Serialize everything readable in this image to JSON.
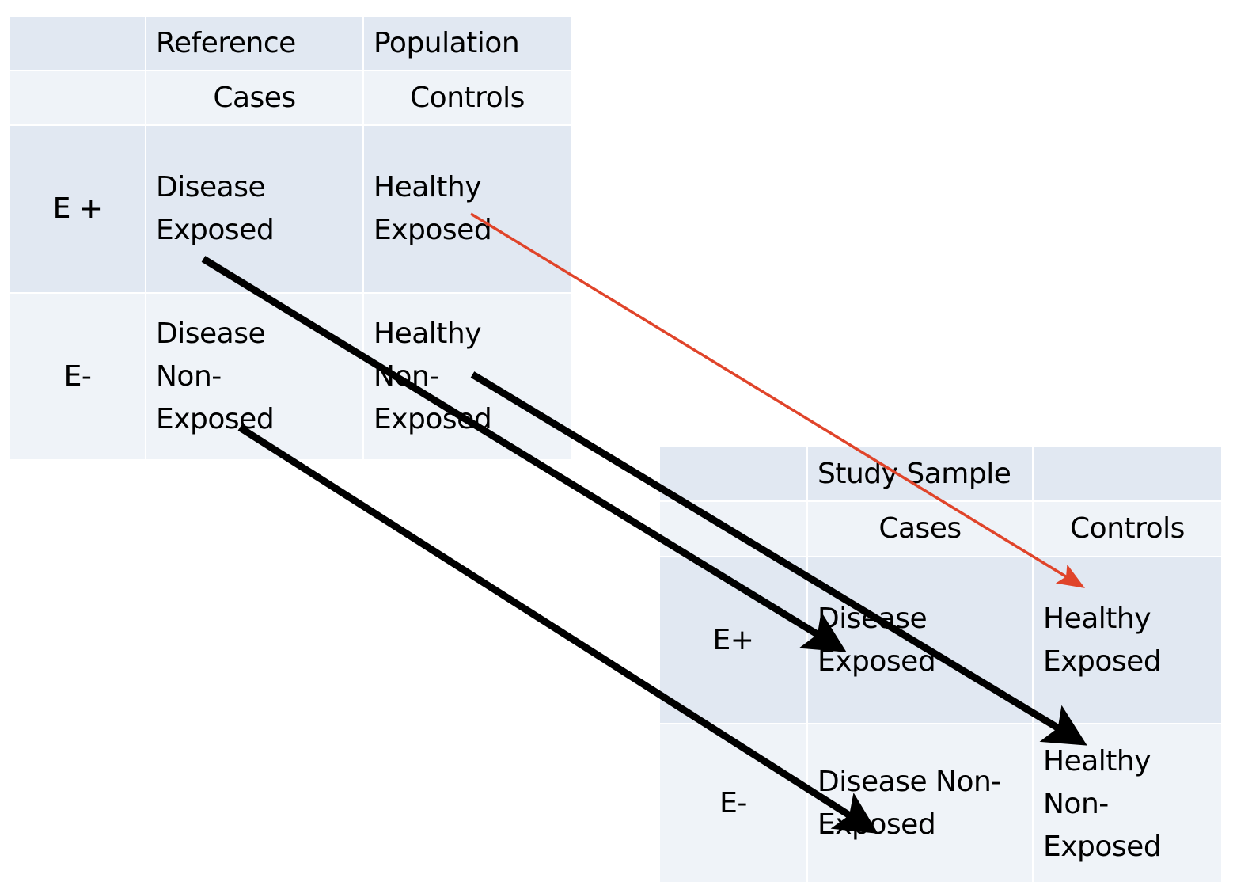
{
  "reference_table": {
    "header_row": [
      "",
      "Reference",
      "Population"
    ],
    "subheader_row": [
      "",
      "Cases",
      "Controls"
    ],
    "rows": [
      {
        "label": "E +",
        "cases": "Disease Exposed",
        "cases_lines": [
          "Disease",
          "Exposed"
        ],
        "controls_lines": [
          "Healthy",
          "Exposed"
        ]
      },
      {
        "label": "E-",
        "cases_lines": [
          "Disease",
          "Non-",
          "Exposed"
        ],
        "controls_lines": [
          "Healthy",
          "Non-",
          "Exposed"
        ]
      }
    ]
  },
  "study_table": {
    "header_row": [
      "",
      "Study Sample",
      ""
    ],
    "subheader_row": [
      "",
      "Cases",
      "Controls"
    ],
    "rows": [
      {
        "label": "E+",
        "cases_lines": [
          "Disease",
          "Exposed"
        ],
        "controls_lines": [
          "Healthy",
          "Exposed"
        ]
      },
      {
        "label": "E-",
        "cases_lines": [
          "Disease Non-",
          "Exposed"
        ],
        "controls_lines": [
          "Healthy",
          "Non-",
          "Exposed"
        ]
      }
    ]
  },
  "arrows": [
    {
      "from": "reference.disease_exposed",
      "to": "study.disease_exposed",
      "color": "#000000"
    },
    {
      "from": "reference.healthy_non_exposed",
      "to": "study.healthy_non_exposed",
      "color": "#000000"
    },
    {
      "from": "reference.disease_non_exposed",
      "to": "study.disease_non_exposed",
      "color": "#000000"
    },
    {
      "from": "reference.healthy_exposed",
      "to": "study.healthy_exposed",
      "color": "#e0442a"
    }
  ],
  "colors": {
    "row_dark": "#e1e8f2",
    "row_light": "#eff3f8",
    "highlight_arrow": "#e0442a"
  }
}
